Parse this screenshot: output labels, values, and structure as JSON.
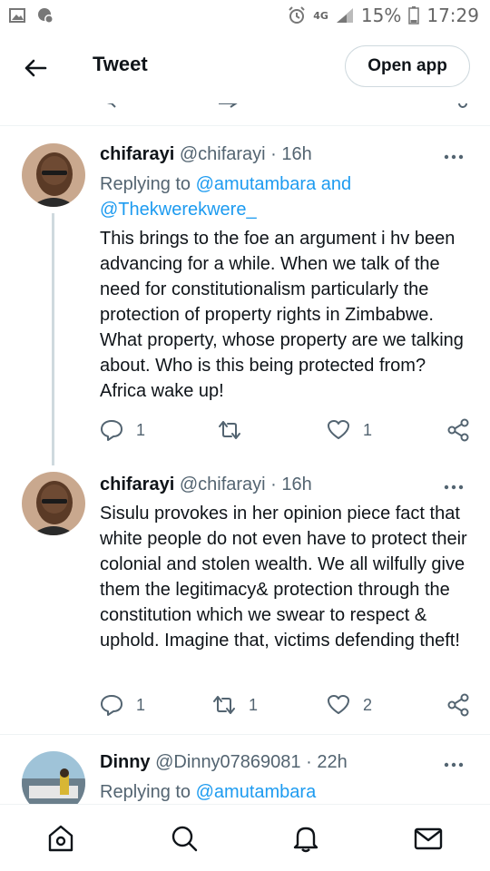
{
  "status_bar": {
    "network": "4G",
    "battery": "15%",
    "time": "17:29"
  },
  "header": {
    "title": "Tweet",
    "open_app_label": "Open app"
  },
  "tweets": [
    {
      "name": "chifarayi",
      "handle": "@chifarayi",
      "separator": "·",
      "time": "16h",
      "replying_prefix": "Replying to",
      "replying_to_1": "@amutambara",
      "replying_and": "and",
      "replying_to_2": "@Thekwerekwere_",
      "text": "This brings to the foe an argument i hv been advancing for a while. When we talk of the need for constitutionalism particularly the protection of property rights in Zimbabwe. What property, whose property are we talking about. Who is this being protected from? Africa wake up!",
      "replies": "1",
      "retweets": "",
      "likes": "1"
    },
    {
      "name": "chifarayi",
      "handle": "@chifarayi",
      "separator": "·",
      "time": "16h",
      "text": "Sisulu provokes in her opinion piece fact that white people do not even have to protect their colonial and stolen wealth. We all wilfully give them the legitimacy& protection through the constitution which we swear to respect & uphold. Imagine that, victims defending theft!",
      "replies": "1",
      "retweets": "1",
      "likes": "2"
    },
    {
      "name": "Dinny",
      "handle": "@Dinny07869081",
      "separator": "·",
      "time": "22h",
      "replying_prefix": "Replying to",
      "replying_to_1": "@amutambara"
    }
  ],
  "icons": {
    "back": "arrow-left-icon",
    "more": "more-horizontal-icon",
    "reply": "reply-icon",
    "retweet": "retweet-icon",
    "like": "heart-icon",
    "share": "share-icon",
    "nav": [
      "home-icon",
      "search-icon",
      "notifications-icon",
      "messages-icon"
    ]
  },
  "colors": {
    "link": "#1d9bf0",
    "muted": "#536471",
    "text": "#0f1419",
    "border": "#cfd9de"
  }
}
